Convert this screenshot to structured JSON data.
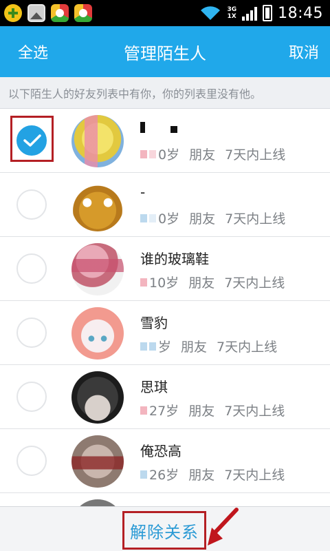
{
  "status_bar": {
    "time": "18:45",
    "network_top": "3G",
    "network_bottom": "1X"
  },
  "header": {
    "select_all": "全选",
    "title": "管理陌生人",
    "cancel": "取消"
  },
  "hint": "以下陌生人的好友列表中有你，你的列表里没有他。",
  "rows": [
    {
      "name": "",
      "age": "0岁",
      "relation": "朋友",
      "online": "7天内上线",
      "checked": true
    },
    {
      "name": "-",
      "age": "0岁",
      "relation": "朋友",
      "online": "7天内上线",
      "checked": false
    },
    {
      "name": "谁的玻璃鞋",
      "age": "10岁",
      "relation": "朋友",
      "online": "7天内上线",
      "checked": false
    },
    {
      "name": "雪豹",
      "age": "岁",
      "relation": "朋友",
      "online": "7天内上线",
      "checked": false
    },
    {
      "name": "思琪",
      "age": "27岁",
      "relation": "朋友",
      "online": "7天内上线",
      "checked": false
    },
    {
      "name": "俺恐高",
      "age": "26岁",
      "relation": "朋友",
      "online": "7天内上线",
      "checked": false
    }
  ],
  "bottom": {
    "remove_relation": "解除关系"
  },
  "colors": {
    "accent": "#20a8ea",
    "highlight_box": "#b41f24",
    "link_text": "#2b9ad5"
  }
}
